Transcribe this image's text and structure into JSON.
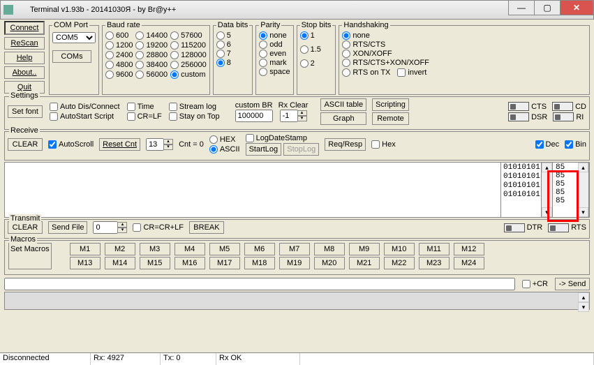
{
  "window": {
    "title": "Terminal v1.93b - 20141030Я - by Br@y++"
  },
  "leftbtns": {
    "connect": "Connect",
    "rescan": "ReScan",
    "help": "Help",
    "about": "About..",
    "quit": "Quit"
  },
  "comport": {
    "legend": "COM Port",
    "value": "COM5",
    "coms_btn": "COMs"
  },
  "baud": {
    "legend": "Baud rate",
    "col1": [
      "600",
      "1200",
      "2400",
      "4800",
      "9600"
    ],
    "col2": [
      "14400",
      "19200",
      "28800",
      "38400",
      "56000"
    ],
    "col3": [
      "57600",
      "115200",
      "128000",
      "256000",
      "custom"
    ]
  },
  "databits": {
    "legend": "Data bits",
    "opts": [
      "5",
      "6",
      "7",
      "8"
    ],
    "selected": "8"
  },
  "parity": {
    "legend": "Parity",
    "opts": [
      "none",
      "odd",
      "even",
      "mark",
      "space"
    ],
    "selected": "none"
  },
  "stopbits": {
    "legend": "Stop bits",
    "opts": [
      "1",
      "1.5",
      "2"
    ],
    "selected": "1"
  },
  "handshake": {
    "legend": "Handshaking",
    "opts": [
      "none",
      "RTS/CTS",
      "XON/XOFF",
      "RTS/CTS+XON/XOFF",
      "RTS on TX"
    ],
    "selected": "none",
    "invert": "invert"
  },
  "settings": {
    "legend": "Settings",
    "setfont": "Set font",
    "autodis": "Auto Dis/Connect",
    "autostart": "AutoStart Script",
    "time": "Time",
    "crlf": "CR=LF",
    "streamlog": "Stream log",
    "stayontop": "Stay on Top",
    "custombr": "custom BR",
    "custombr_val": "100000",
    "rxclear": "Rx Clear",
    "rxclear_val": "-1",
    "ascii": "ASCII table",
    "scripting": "Scripting",
    "graph": "Graph",
    "remote": "Remote"
  },
  "leds": {
    "cts": "CTS",
    "cd": "CD",
    "dsr": "DSR",
    "ri": "RI",
    "dtr": "DTR",
    "rts": "RTS"
  },
  "receive": {
    "legend": "Receive",
    "clear": "CLEAR",
    "autoscroll": "AutoScroll",
    "resetcnt": "Reset Cnt",
    "spin_val": "13",
    "cntlabel": "Cnt =  0",
    "hex": "HEX",
    "ascii": "ASCII",
    "logdate": "LogDateStamp",
    "startlog": "StartLog",
    "stoplog": "StopLog",
    "reqresp": "Req/Resp",
    "hex2": "Hex",
    "dec": "Dec",
    "bin": "Bin",
    "bin_lines": [
      "01010101",
      "01010101",
      "01010101",
      "01010101"
    ],
    "dec_lines": [
      "85",
      "85",
      "85",
      "85",
      "85"
    ]
  },
  "transmit": {
    "legend": "Transmit",
    "clear": "CLEAR",
    "sendfile": "Send File",
    "spin": "0",
    "crcrlf": "CR=CR+LF",
    "break": "BREAK"
  },
  "macros": {
    "legend": "Macros",
    "set": "Set Macros",
    "row1": [
      "M1",
      "M2",
      "M3",
      "M4",
      "M5",
      "M6",
      "M7",
      "M8",
      "M9",
      "M10",
      "M11",
      "M12"
    ],
    "row2": [
      "M13",
      "M14",
      "M15",
      "M16",
      "M17",
      "M18",
      "M19",
      "M20",
      "M21",
      "M22",
      "M23",
      "M24"
    ]
  },
  "bottom": {
    "cr": "+CR",
    "send": "-> Send"
  },
  "status": {
    "conn": "Disconnected",
    "rx": "Rx: 4927",
    "tx": "Tx: 0",
    "ok": "Rx OK"
  }
}
